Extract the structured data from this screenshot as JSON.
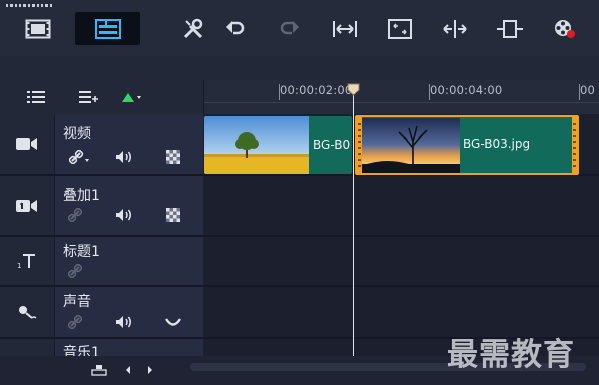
{
  "toolbar": {
    "buttons": [
      "storyboard-view",
      "timeline-view",
      "tools",
      "undo",
      "redo",
      "fit-to-window",
      "smart-proxy",
      "trim-left-right",
      "duplicate",
      "record"
    ]
  },
  "ruler": {
    "labels": [
      "00:00:02:00",
      "00:00:04:00",
      "00"
    ]
  },
  "tracks": [
    {
      "name": "视频"
    },
    {
      "name": "叠加1"
    },
    {
      "name": "标题1"
    },
    {
      "name": "声音"
    },
    {
      "name": "音乐1"
    }
  ],
  "clips": {
    "clip1_label": "BG-B0",
    "clip2_label": "BG-B03.jpg"
  },
  "watermark": "最需教育",
  "colors": {
    "accent": "#2fb7ff",
    "clip_bg": "#126b5a",
    "selected_border": "#f0a21c",
    "add_triangle": "#35d468"
  }
}
